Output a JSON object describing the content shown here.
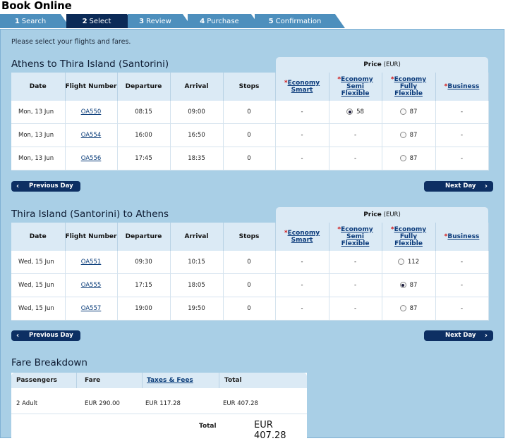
{
  "page": {
    "title": "Book Online"
  },
  "tabs": [
    {
      "num": "1",
      "label": "Search"
    },
    {
      "num": "2",
      "label": "Select"
    },
    {
      "num": "3",
      "label": "Review"
    },
    {
      "num": "4",
      "label": "Purchase"
    },
    {
      "num": "5",
      "label": "Confirmation"
    }
  ],
  "intro": "Please select your flights and fares.",
  "price_header": {
    "label": "Price",
    "unit": "(EUR)"
  },
  "columns": {
    "date": "Date",
    "flight": "Flight Number",
    "departure": "Departure",
    "arrival": "Arrival",
    "stops": "Stops",
    "fares": [
      {
        "l1": "Economy",
        "l2": "Smart",
        "l3": ""
      },
      {
        "l1": "Economy",
        "l2": "Semi",
        "l3": "Flexible"
      },
      {
        "l1": "Economy",
        "l2": "Fully",
        "l3": "Flexible"
      },
      {
        "l1": "Business",
        "l2": "",
        "l3": ""
      }
    ]
  },
  "outbound": {
    "title": "Athens to Thira Island (Santorini)",
    "rows": [
      {
        "date": "Mon, 13 Jun",
        "flight": "OA550",
        "dep": "08:15",
        "arr": "09:00",
        "stops": "0",
        "f1": "-",
        "f2": "58",
        "f2_selected": true,
        "f3": "87",
        "f3_selected": false,
        "f4": "-"
      },
      {
        "date": "Mon, 13 Jun",
        "flight": "OA554",
        "dep": "16:00",
        "arr": "16:50",
        "stops": "0",
        "f1": "-",
        "f2": "-",
        "f3": "87",
        "f3_selected": false,
        "f4": "-"
      },
      {
        "date": "Mon, 13 Jun",
        "flight": "OA556",
        "dep": "17:45",
        "arr": "18:35",
        "stops": "0",
        "f1": "-",
        "f2": "-",
        "f3": "87",
        "f3_selected": false,
        "f4": "-"
      }
    ]
  },
  "inbound": {
    "title": "Thira Island (Santorini) to Athens",
    "rows": [
      {
        "date": "Wed, 15 Jun",
        "flight": "OA551",
        "dep": "09:30",
        "arr": "10:15",
        "stops": "0",
        "f1": "-",
        "f2": "-",
        "f3": "112",
        "f3_selected": false,
        "f4": "-"
      },
      {
        "date": "Wed, 15 Jun",
        "flight": "OA555",
        "dep": "17:15",
        "arr": "18:05",
        "stops": "0",
        "f1": "-",
        "f2": "-",
        "f3": "87",
        "f3_selected": true,
        "f4": "-"
      },
      {
        "date": "Wed, 15 Jun",
        "flight": "OA557",
        "dep": "19:00",
        "arr": "19:50",
        "stops": "0",
        "f1": "-",
        "f2": "-",
        "f3": "87",
        "f3_selected": false,
        "f4": "-"
      }
    ]
  },
  "nav": {
    "prev": "Previous Day",
    "next": "Next Day"
  },
  "fare_breakdown": {
    "title": "Fare Breakdown",
    "headers": {
      "passengers": "Passengers",
      "fare": "Fare",
      "taxes": "Taxes & Fees",
      "total": "Total"
    },
    "row": {
      "passengers": "2 Adult",
      "fare": "EUR 290.00",
      "taxes": "EUR 117.28",
      "total": "EUR 407.28"
    },
    "total_label": "Total",
    "total_value": "EUR 407.28"
  },
  "colors": {
    "panel": "#a9cfe6",
    "tab": "#4d8fbd",
    "tab_active": "#0b2a57",
    "button": "#0d2f63",
    "required_star": "#d01010"
  }
}
